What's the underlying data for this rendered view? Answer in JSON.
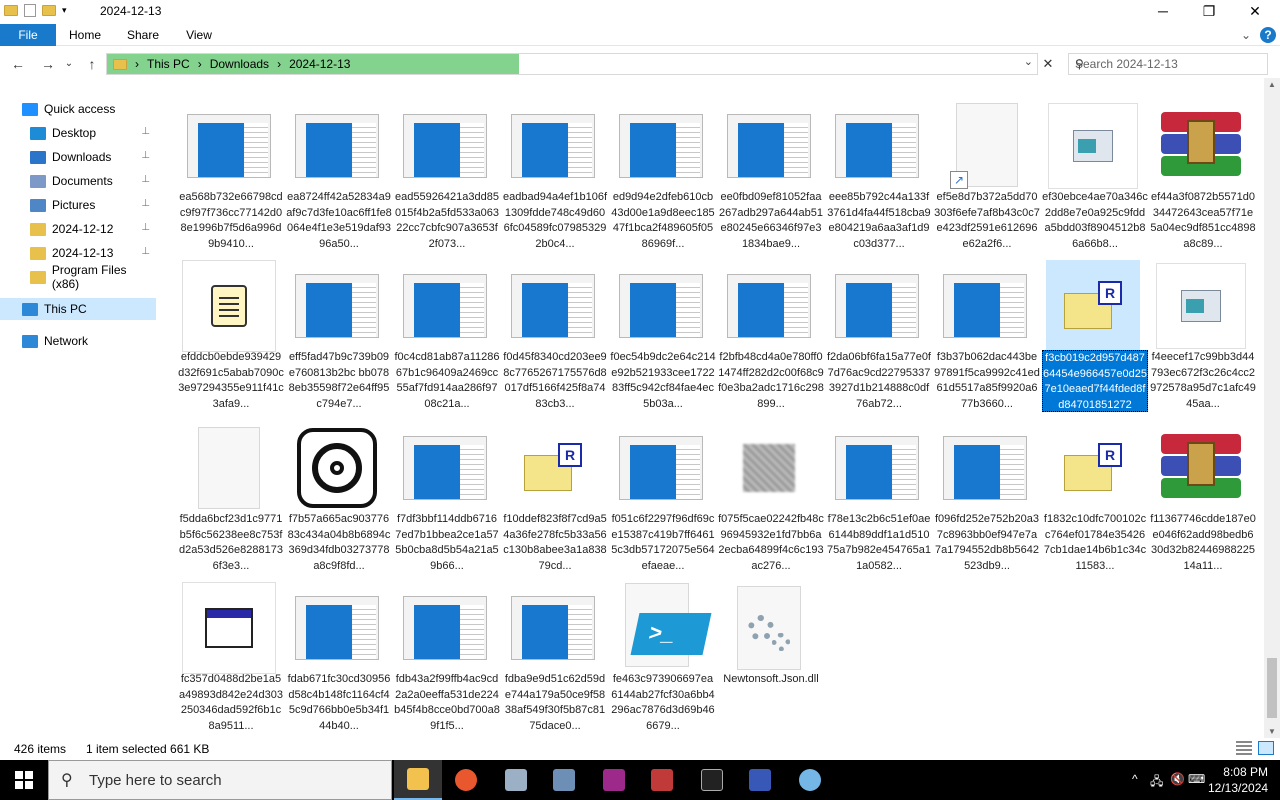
{
  "window": {
    "title": "2024-12-13",
    "minimize": "─",
    "maximize": "❐",
    "close": "✕"
  },
  "ribbon": {
    "tabs": [
      "File",
      "Home",
      "Share",
      "View"
    ],
    "expand": "⌄",
    "help": "?"
  },
  "nav": {
    "back": "←",
    "forward": "→",
    "recent": "⌄",
    "up": "↑"
  },
  "address": {
    "crumbs": [
      "This PC",
      "Downloads",
      "2024-12-13"
    ],
    "sep": "›",
    "dropdown": "⌄",
    "clear": "✕"
  },
  "search": {
    "placeholder": "Search 2024-12-13",
    "icon": "⚲"
  },
  "sidebar": {
    "items": [
      {
        "label": "Quick access",
        "icon": "star-icon",
        "color": "#1e90ff",
        "pinned": false
      },
      {
        "label": "Desktop",
        "icon": "desktop-icon",
        "color": "#1e8bd6",
        "pinned": true
      },
      {
        "label": "Downloads",
        "icon": "downloads-icon",
        "color": "#2a74c9",
        "pinned": true
      },
      {
        "label": "Documents",
        "icon": "documents-icon",
        "color": "#7d99c7",
        "pinned": true
      },
      {
        "label": "Pictures",
        "icon": "pictures-icon",
        "color": "#4f86c6",
        "pinned": true
      },
      {
        "label": "2024-12-12",
        "icon": "folder-icon",
        "color": "#e8c04c",
        "pinned": true
      },
      {
        "label": "2024-12-13",
        "icon": "folder-icon",
        "color": "#e8c04c",
        "pinned": true
      },
      {
        "label": "Program Files (x86)",
        "icon": "folder-icon",
        "color": "#e8c04c",
        "pinned": false
      },
      {
        "label": "This PC",
        "icon": "pc-icon",
        "color": "#2d89d8",
        "pinned": false
      },
      {
        "label": "Network",
        "icon": "network-icon",
        "color": "#2d89d8",
        "pinned": false
      }
    ],
    "pin_glyph": "📌"
  },
  "files": [
    {
      "name": "ea568b732e66798cdc9f97f736cc77142d08e1996b7f5d6a996d9b9410...",
      "kind": "shot"
    },
    {
      "name": "ea8724ff42a52834a9af9c7d3fe10ac6ff1fe8064e4f1e3e519daf9396a50...",
      "kind": "shot"
    },
    {
      "name": "ead55926421a3dd85015f4b2a5fd533a06322cc7cbfc907a3653f2f073...",
      "kind": "shot"
    },
    {
      "name": "eadbad94a4ef1b106f1309fdde748c49d606fc04589fc079853292b0c4...",
      "kind": "shot"
    },
    {
      "name": "ed9d94e2dfeb610cb43d00e1a9d8eec18547f1bca2f489605f0586969f...",
      "kind": "shot"
    },
    {
      "name": "ee0fbd09ef81052faa267adb297a644ab51e80245e66346f97e31834bae9...",
      "kind": "shot"
    },
    {
      "name": "eee85b792c44a133f3761d4fa44f518cba9e804219a6aa3af1d9c03d377...",
      "kind": "shot"
    },
    {
      "name": "ef5e8d7b372a5dd70303f6efe7af8b43c0c7e423df2591e612696e62a2f6...",
      "kind": "blank-shortcut"
    },
    {
      "name": "ef30ebce4ae70a346c2dd8e7e0a925c9fdda5bdd03f8904512b86a66b8...",
      "kind": "app"
    },
    {
      "name": "ef44a3f0872b5571d034472643cea57f71e5a04ec9df851cc4898a8c89...",
      "kind": "rar"
    },
    {
      "name": "efddcb0ebde939429d32f691c5abab7090c3e97294355e911f41c3afa9...",
      "kind": "script"
    },
    {
      "name": "eff5fad47b9c739b09e760813b2bc bb0788eb35598f72e64ff95c794e7...",
      "kind": "shot"
    },
    {
      "name": "f0c4cd81ab87a1128667b1c96409a2469cc55af7fd914aa286f9708c21a...",
      "kind": "shot"
    },
    {
      "name": "f0d45f8340cd203ee98c7765267175576d8017df5166f425f8a7483cb3...",
      "kind": "shot"
    },
    {
      "name": "f0ec54b9dc2e64c214e92b521933cee172283ff5c942cf84fae4ec5b03a...",
      "kind": "shot"
    },
    {
      "name": "f2bfb48cd4a0e780ff01474ff282d2c00f68c9f0e3ba2adc1716c298899...",
      "kind": "shot"
    },
    {
      "name": "f2da06bf6fa15a77e0f7d76ac9cd227953373927d1b214888c0df76ab72...",
      "kind": "shot"
    },
    {
      "name": "f3b37b062dac443be97891f5ca9992c41ed61d5517a85f9920a677b3660...",
      "kind": "shot"
    },
    {
      "name": "f3cb019c2d957d48764454e966457e0d257e10eaed7f44fded8fd84701851272",
      "kind": "rdp",
      "selected": true
    },
    {
      "name": "f4eecef17c99bb3d44793ec672f3c26c4cc2972578a95d7c1afc4945aa...",
      "kind": "app"
    },
    {
      "name": "f5dda6bcf23d1c9771b5f6c56238ee8c753fd2a53d526e82881736f3e3...",
      "kind": "blank"
    },
    {
      "name": "f7b57a665ac90377683c434a04b8b6894c369d34fdb03273778a8c9f8fd...",
      "kind": "logo"
    },
    {
      "name": "f7df3bbf114ddb67167ed7b1bbea2ce1a575b0cba8d5b54a21a59b66...",
      "kind": "shot"
    },
    {
      "name": "f10ddef823f8f7cd9a54a36fe278fc5b33a56c130b8abee3a1a83879cd...",
      "kind": "rdp"
    },
    {
      "name": "f051c6f2297f96df69ce15387c419b7ff64615c3db57172075e564efaeae...",
      "kind": "shot"
    },
    {
      "name": "f075f5cae02242fb48c96945932e1fd7bb6a2ecba64899f4c6c193ac276...",
      "kind": "gray"
    },
    {
      "name": "f78e13c2b6c51ef0ae6144b89ddf1a1d51075a7b982e454765a11a0582...",
      "kind": "shot"
    },
    {
      "name": "f096fd252e752b20a37c8963bb0ef947e7a7a1794552db8b5642523db9...",
      "kind": "shot"
    },
    {
      "name": "f1832c10dfc700102cc764ef01784e354267cb1dae14b6b1c34c11583...",
      "kind": "rdp"
    },
    {
      "name": "f11367746cdde187e0e046f62add98bedb630d32b8244698822514a11...",
      "kind": "rar"
    },
    {
      "name": "fc357d0488d2be1a5a49893d842e24d303250346dad592f6b1c8a9511...",
      "kind": "window"
    },
    {
      "name": "fdab671fc30cd30956d58c4b148fc1164cf45c9d766bb0e5b34f144b40...",
      "kind": "shot"
    },
    {
      "name": "fdb43a2f99ffb4ac9cd2a2a0eeffa531de224b45f4b8cce0bd700a89f1f5...",
      "kind": "shot"
    },
    {
      "name": "fdba9e9d51c62d59de744a179a50ce9f5838af549f30f5b87c8175dace0...",
      "kind": "shot"
    },
    {
      "name": "fe463c973906697ea6144ab27fcf30a6bb4296ac7876d3d69b466679...",
      "kind": "powershell"
    },
    {
      "name": "Newtonsoft.Json.dll",
      "kind": "dll"
    }
  ],
  "status": {
    "count": "426 items",
    "selected": "1 item selected  661 KB"
  },
  "taskbar": {
    "search_placeholder": "Type here to search",
    "apps": [
      "file-explorer-icon",
      "firefox-icon",
      "app-icon",
      "network-app-icon",
      "winrar-icon",
      "spark-icon",
      "terminal-icon",
      "winrar-multi-icon",
      "globe-icon"
    ],
    "tray_icons": [
      "^",
      "🖧",
      "🔇",
      "⌨"
    ],
    "time": "8:08 PM",
    "date": "12/13/2024"
  },
  "colors": {
    "accent": "#1979ca",
    "address_progress": "#83d28e",
    "selection": "#cce8ff"
  }
}
